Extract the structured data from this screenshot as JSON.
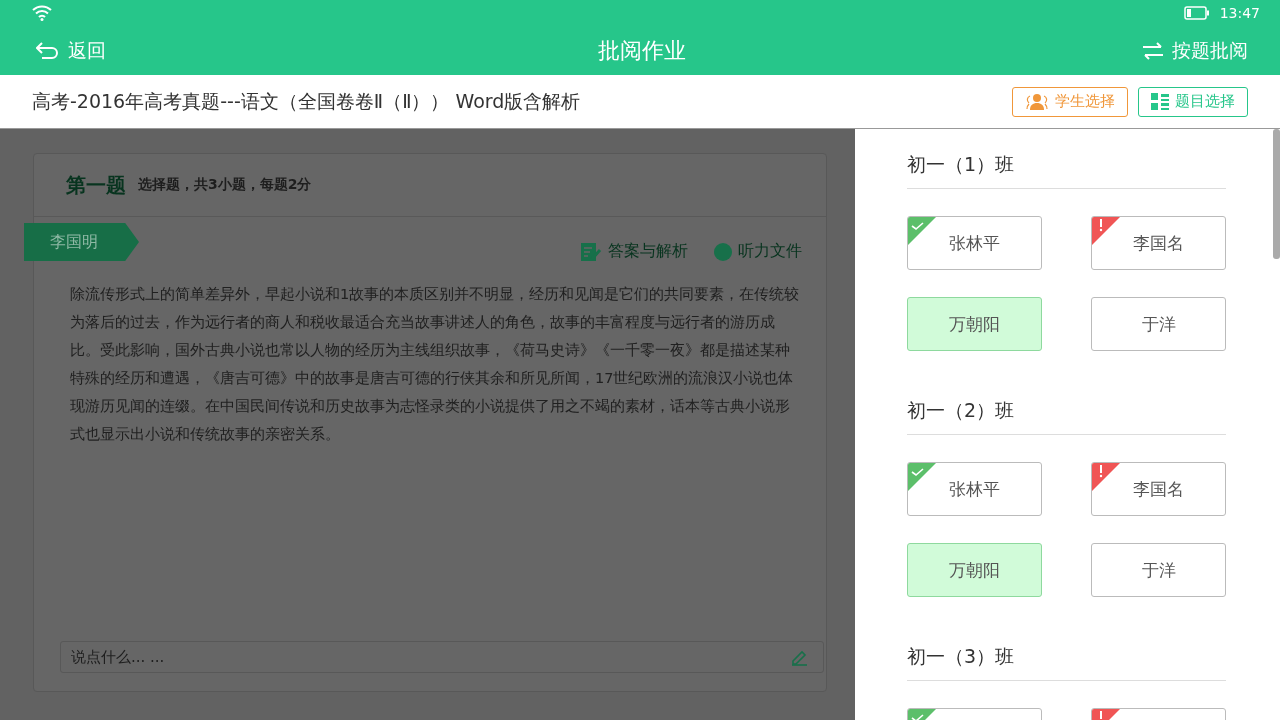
{
  "status_bar": {
    "time": "13:47"
  },
  "header": {
    "back": "返回",
    "title": "批阅作业",
    "mode": "按题批阅"
  },
  "subheader": {
    "title": "高考-2016年高考真题---语文（全国卷卷Ⅱ（Ⅱ）） Word版含解析",
    "buttons": [
      {
        "kind": "student",
        "label": "学生选择"
      },
      {
        "kind": "question",
        "label": "题目选择"
      }
    ]
  },
  "question": {
    "number": "第一题",
    "info": "选择题，共3小题，每题2分",
    "student": "李国明",
    "links": [
      {
        "kind": "answer",
        "label": "答案与解析"
      },
      {
        "kind": "audio",
        "label": "听力文件"
      }
    ],
    "text": "除流传形式上的简单差异外，早起小说和1故事的本质区别并不明显，经历和见闻是它们的共同要素，在传统较为落后的过去，作为远行者的商人和税收最适合充当故事讲述人的角色，故事的丰富程度与远行者的游历成比。受此影响，国外古典小说也常以人物的经历为主线组织故事，《荷马史诗》《一千零一夜》都是描述某种特殊的经历和遭遇，《唐吉可德》中的故事是唐吉可德的行侠其余和所见所闻，17世纪欧洲的流浪汉小说也体现游历见闻的连缀。在中国民间传说和历史故事为志怪录类的小说提供了用之不竭的素材，话本等古典小说形式也显示出小说和传统故事的亲密关系。",
    "comment": {
      "placeholder": "说点什么... ..."
    }
  },
  "classes": [
    {
      "name": "初一（1）班",
      "students": [
        {
          "name": "张林平",
          "kind": "correct",
          "selected": false
        },
        {
          "name": "李国名",
          "kind": "wrong",
          "selected": false
        },
        {
          "name": "万朝阳",
          "kind": "plain",
          "selected": true
        },
        {
          "name": "于洋",
          "kind": "plain",
          "selected": false
        }
      ]
    },
    {
      "name": "初一（2）班",
      "students": [
        {
          "name": "张林平",
          "kind": "correct",
          "selected": false
        },
        {
          "name": "李国名",
          "kind": "wrong",
          "selected": false
        },
        {
          "name": "万朝阳",
          "kind": "plain",
          "selected": true
        },
        {
          "name": "于洋",
          "kind": "plain",
          "selected": false
        }
      ]
    },
    {
      "name": "初一（3）班",
      "students": [
        {
          "kind": "correct",
          "selected": false
        },
        {
          "kind": "wrong",
          "selected": false
        }
      ]
    }
  ]
}
